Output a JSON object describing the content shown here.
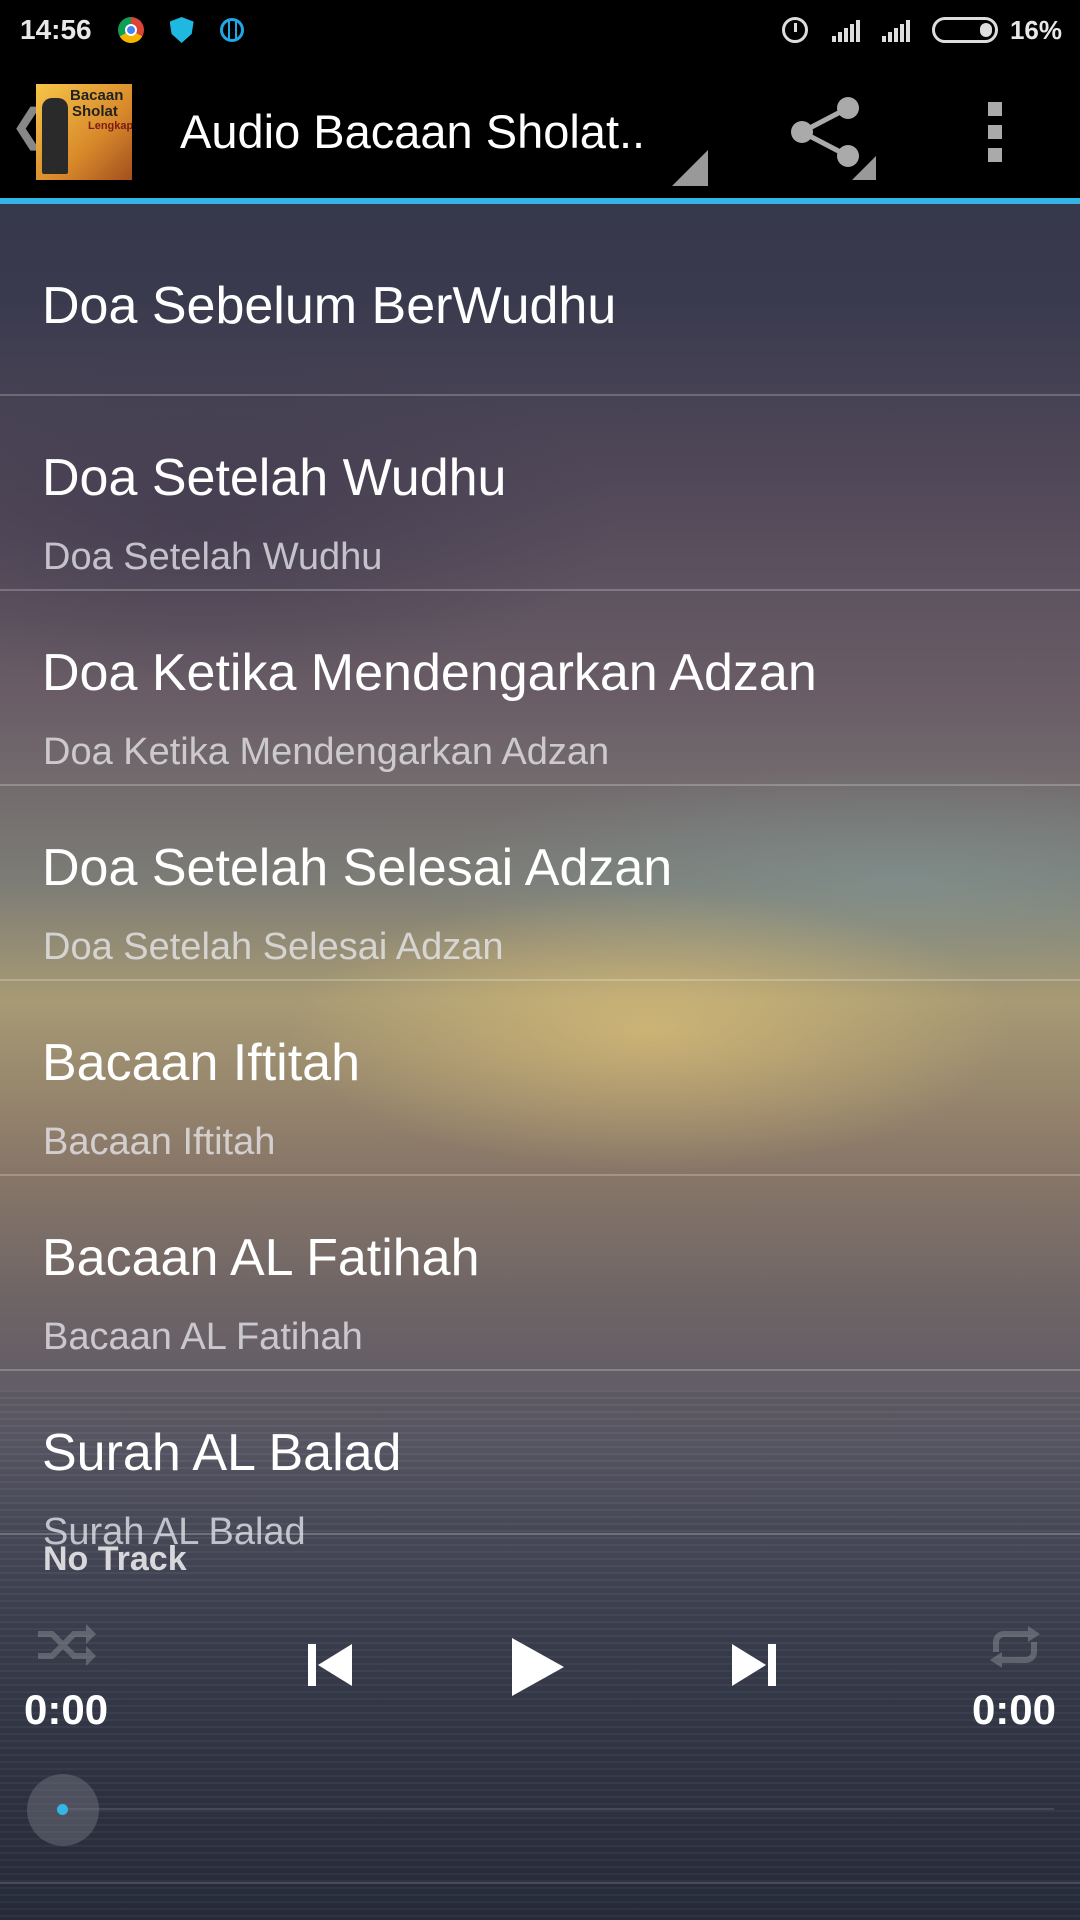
{
  "status_bar": {
    "time": "14:56",
    "battery": "16%",
    "icons": [
      "chrome-icon",
      "shield-icon",
      "globe-icon",
      "alarm-icon",
      "signal-icon",
      "signal-icon",
      "battery-icon"
    ]
  },
  "action_bar": {
    "title": "Audio Bacaan Sholat..",
    "logo_text": [
      "Bacaan",
      "Sholat",
      "Lengkap"
    ],
    "accent_color": "#33b5e5"
  },
  "tracks": [
    {
      "title": "Doa Sebelum BerWudhu",
      "subtitle": ""
    },
    {
      "title": "Doa Setelah Wudhu",
      "subtitle": "Doa Setelah Wudhu"
    },
    {
      "title": "Doa Ketika Mendengarkan Adzan",
      "subtitle": "Doa Ketika Mendengarkan Adzan"
    },
    {
      "title": "Doa Setelah Selesai Adzan",
      "subtitle": "Doa Setelah Selesai Adzan"
    },
    {
      "title": "Bacaan Iftitah",
      "subtitle": "Bacaan Iftitah"
    },
    {
      "title": "Bacaan AL Fatihah",
      "subtitle": "Bacaan AL Fatihah"
    },
    {
      "title": "Surah AL Balad",
      "subtitle": "Surah AL Balad"
    }
  ],
  "player": {
    "now_playing": "No Track",
    "elapsed": "0:00",
    "duration": "0:00",
    "progress": 0
  }
}
